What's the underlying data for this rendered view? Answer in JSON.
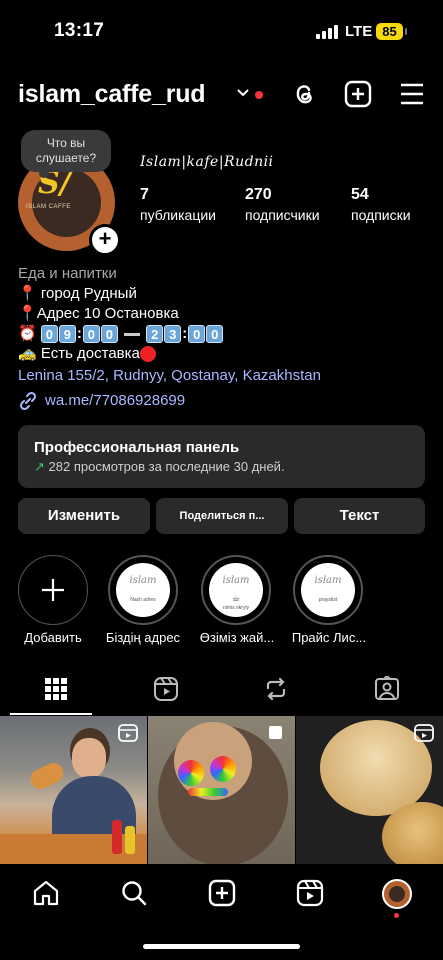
{
  "status_bar": {
    "time": "13:17",
    "network": "LTE",
    "battery": "85"
  },
  "header": {
    "username": "islam_caffe_rud"
  },
  "profile": {
    "note": "Что вы слушаете?",
    "display_name": "Islam|kafe|Rudnii",
    "stats": [
      {
        "value": "7",
        "label": "публикации"
      },
      {
        "value": "270",
        "label": "подписчики"
      },
      {
        "value": "54",
        "label": "подписки"
      }
    ]
  },
  "bio": {
    "category": "Еда и напитки",
    "city": "город Рудный",
    "address": "Адрес 10 Остановка",
    "hours_open": [
      "0",
      "9",
      "0",
      "0"
    ],
    "hours_close": [
      "2",
      "3",
      "0",
      "0"
    ],
    "delivery": "Есть доставка",
    "location": "Lenina 155/2, Rudnyy, Qostanay, Kazakhstan",
    "website": "wa.me/77086928699"
  },
  "pro_panel": {
    "title": "Профессиональная панель",
    "subtitle": "282 просмотров за последние 30 дней."
  },
  "buttons": {
    "edit": "Изменить",
    "share": "Поделиться п...",
    "text": "Текст"
  },
  "highlights": [
    {
      "label": "Добавить"
    },
    {
      "label": "Біздің адрес",
      "script": "islam",
      "caption": "Nash adres"
    },
    {
      "label": "Өзіміз жай...",
      "script": "islam",
      "caption": "nimis okryly"
    },
    {
      "label": "Прайс Лис...",
      "script": "islam",
      "caption": "praystist"
    }
  ],
  "tabs": [
    "grid-icon",
    "reels-icon",
    "reposts-icon",
    "tagged-icon"
  ],
  "colors": {
    "background": "#000000",
    "link": "#a9b7ff",
    "accent_red": "#ff3040",
    "battery": "#f5d90a"
  }
}
